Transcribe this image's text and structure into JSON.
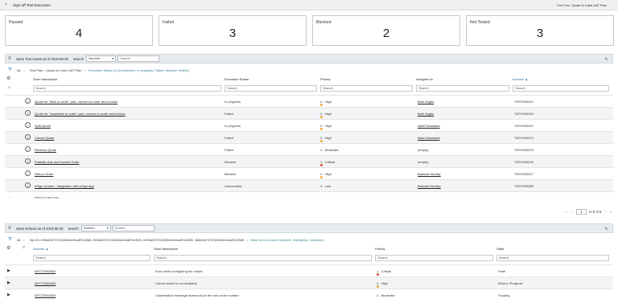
{
  "titlebar": {
    "title": "Sign-off Test Execution",
    "crumb_prefix": "Test Plan",
    "crumb_value": "Quote to Cash UAT Plan"
  },
  "cards": [
    {
      "label": "Passed",
      "value": "4"
    },
    {
      "label": "Failed",
      "value": "3"
    },
    {
      "label": "Blocked",
      "value": "2"
    },
    {
      "label": "Not Tested",
      "value": "3"
    }
  ],
  "tests": {
    "title": "Open Test Cases as of 2019-05-30",
    "search_label": "Search",
    "field_select": "Number",
    "search_placeholder": "Search",
    "filter": {
      "all": "All",
      "plan": "Test Plan = Quote to Cash UAT Plan",
      "status": "Execution Status in (Unexecuted, In progress, Failed, Blocked, Retest)"
    },
    "columns": [
      "Short description",
      "Execution Status",
      "Priority",
      "Assigned to",
      "Number"
    ],
    "sort_indicator": "▲",
    "col_search": "Search",
    "rows": [
      {
        "desc": "Quote for \"stick to order\" part, convert to order and invoice",
        "status": "In progress",
        "priority": "2 - High",
        "pcolor": "#f0a830",
        "assigned": "Beth Anglin",
        "assigned_link": true,
        "number": "TMT0000010"
      },
      {
        "desc": "Quote for \"Assemble to order\" part, convert to order and invoice",
        "status": "Failed",
        "priority": "2 - High",
        "pcolor": "#f0a830",
        "assigned": "Beth Anglin",
        "assigned_link": true,
        "number": "TMT0000033"
      },
      {
        "desc": "Split Quote",
        "status": "In progress",
        "priority": "2 - High",
        "pcolor": "#f0a830",
        "assigned": "Allan Schwantd",
        "assigned_link": true,
        "number": "TMT0000022"
      },
      {
        "desc": "Cancel Quote",
        "status": "Failed",
        "priority": "2 - High",
        "pcolor": "#f0a830",
        "assigned": "Allan Schwantd",
        "assigned_link": true,
        "number": "TMT0000023"
      },
      {
        "desc": "Reverse Quote",
        "status": "Failed",
        "priority": "3 - Moderate",
        "pcolor": "",
        "assigned": "(empty)",
        "assigned_link": false,
        "number": "TMT0000025"
      },
      {
        "desc": "Partially ship and invoice Order",
        "status": "Blocked",
        "priority": "1 - Critical",
        "pcolor": "#e04a3a",
        "assigned": "(empty)",
        "assigned_link": false,
        "number": "TMT0000026"
      },
      {
        "desc": "Return Order",
        "status": "Blocked",
        "priority": "2 - High",
        "pcolor": "#f0a830",
        "assigned": "Barbara Hindley",
        "assigned_link": true,
        "number": "TMT0000027"
      },
      {
        "desc": "eSign Quotes - integration with eSign app",
        "status": "Unexecuted",
        "priority": "4 - Low",
        "pcolor": "",
        "assigned": "Barbara Hindley",
        "assigned_link": true,
        "number": "TMT0000085"
      }
    ],
    "insert_label": "Insert a new row...",
    "pager": {
      "first": "«",
      "prev": "‹",
      "page": "1",
      "range": "to 8 of 8",
      "next": "›",
      "last": "»"
    }
  },
  "defects": {
    "title": "Open Defects as of 2019-05-30",
    "search_label": "Search",
    "field_select": "Number",
    "search_placeholder": "Search",
    "filter": {
      "all": "All",
      "sys": "Sys ID in 99bde2073701320b0d416caff7e4358c, f520a0373701320b0d416caff7e4357b, b87ba0373701320b0d416caff7e4353b, 368ee0d73701320b0d416caff7e4358f",
      "state": "State not in (Closed Complete, Testing/QA, Cancelled)"
    },
    "columns": [
      "Number",
      "Short description",
      "Priority",
      "State"
    ],
    "sort_indicator": "▲",
    "col_search": "Search",
    "rows": [
      {
        "number": "DFCT0000002",
        "desc": "Error while configuring the model",
        "priority": "1 - Critical",
        "pcolor": "#e04a3a",
        "state": "Draft"
      },
      {
        "number": "DFCT0000003",
        "desc": "Cancel action is not available",
        "priority": "2 - High",
        "pcolor": "#f0a830",
        "state": "Work in Progress"
      },
      {
        "number": "DFCT0000004",
        "desc": "Confirmation message doesnt show the new order number",
        "priority": "3 - Moderate",
        "pcolor": "",
        "state": "Scoping"
      }
    ]
  }
}
